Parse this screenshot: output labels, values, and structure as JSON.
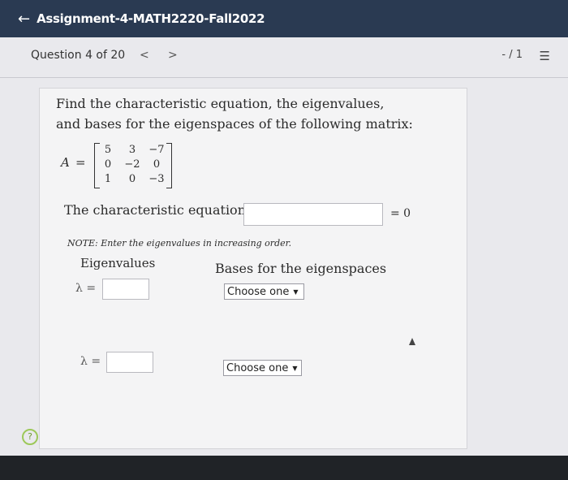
{
  "app": {
    "title": "Assignment-4-MATH2220-Fall2022",
    "back_glyph": "←"
  },
  "question_bar": {
    "position": "Question 4 of 20",
    "prev_glyph": "<",
    "next_glyph": ">",
    "score": "- / 1",
    "list_icon_glyph": "☰"
  },
  "problem": {
    "line1": "Find the characteristic equation, the eigenvalues,",
    "line2": "and bases for the eigenspaces of the following matrix:"
  },
  "matrix": {
    "name": "A",
    "equals": "=",
    "r0c0": "5",
    "r0c1": "3",
    "r0c2": "−7",
    "r1c0": "0",
    "r1c1": "−2",
    "r1c2": "0",
    "r2c0": "1",
    "r2c1": "0",
    "r2c2": "−3"
  },
  "characteristic": {
    "label": "The characteristic equation is",
    "value": "",
    "suffix": "= 0"
  },
  "note": "NOTE: Enter the eigenvalues in increasing order.",
  "headers": {
    "eigenvalues": "Eigenvalues",
    "bases": "Bases for the eigenspaces"
  },
  "rows": [
    {
      "lambda_label": "λ =",
      "value": "",
      "select_label": "Choose one"
    },
    {
      "lambda_label": "λ =",
      "value": "",
      "select_label": "Choose one"
    }
  ],
  "colors": {
    "topbar": "#2a3a52",
    "panel": "#e9e9ed",
    "card": "#f4f4f5",
    "help_accent": "#9dc85a"
  },
  "icons": {
    "back": "arrow-left-icon",
    "list": "list-icon",
    "help": "help-circle-icon",
    "dropdown": "caret-down-icon"
  }
}
